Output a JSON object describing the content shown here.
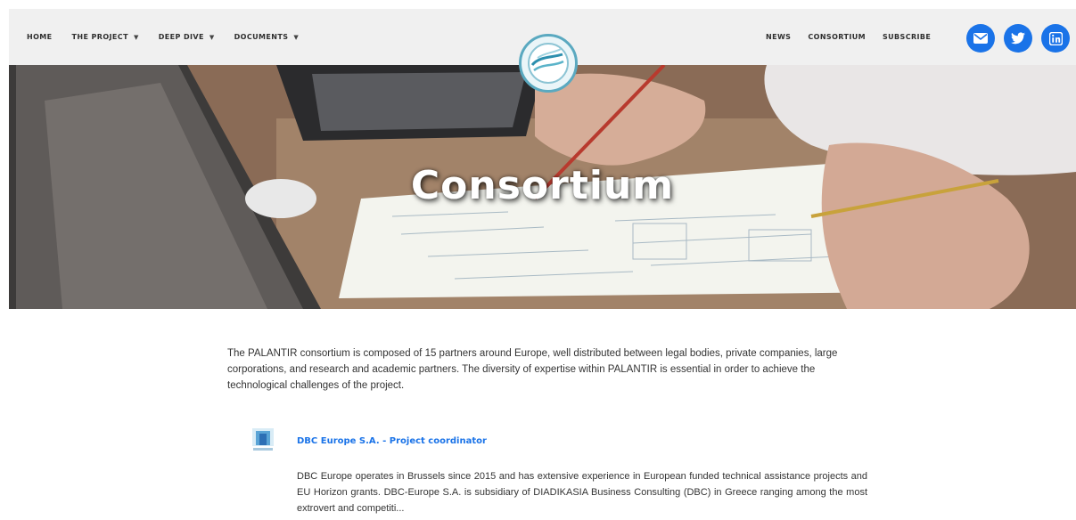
{
  "nav": {
    "left": [
      {
        "label": "HOME",
        "dropdown": false
      },
      {
        "label": "THE PROJECT",
        "dropdown": true
      },
      {
        "label": "DEEP DIVE",
        "dropdown": true
      },
      {
        "label": "DOCUMENTS",
        "dropdown": true
      }
    ],
    "right": [
      {
        "label": "NEWS"
      },
      {
        "label": "CONSORTIUM"
      },
      {
        "label": "SUBSCRIBE"
      }
    ],
    "social_icons": [
      "email-icon",
      "twitter-icon",
      "linkedin-icon"
    ],
    "accent_color": "#1a73e8"
  },
  "hero": {
    "title": "Consortium"
  },
  "intro": "The PALANTIR consortium is composed of 15 partners around Europe, well distributed between legal bodies, private companies, large corporations, and research and academic partners. The diversity of expertise within PALANTIR is essential in order to achieve the technological challenges of the project.",
  "partners": [
    {
      "name": "DBC Europe S.A. - Project coordinator",
      "description": "DBC Europe operates in Brussels since 2015 and has extensive experience in European funded technical assistance projects and EU Horizon grants. DBC-Europe S.A. is subsidiary of DIADIKASIA Business Consulting (DBC) in Greece ranging among the most extrovert and competiti..."
    }
  ]
}
